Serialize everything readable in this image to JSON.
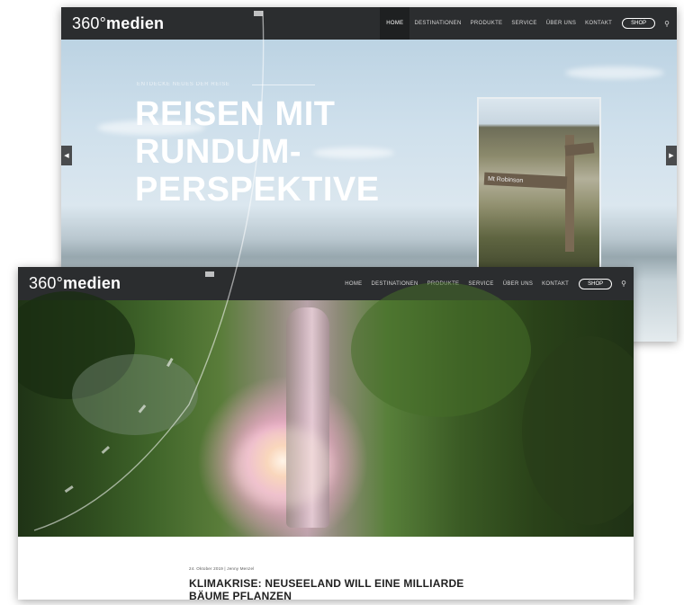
{
  "back_screenshot": {
    "logo": {
      "prefix": "360°",
      "bold": "medien"
    },
    "nav": {
      "items": [
        "HOME",
        "DESTINATIONEN",
        "PRODUKTE",
        "SERVICE",
        "ÜBER UNS",
        "KONTAKT"
      ],
      "active": "HOME",
      "shop_label": "SHOP",
      "search_icon": "search-icon"
    },
    "hero": {
      "kicker": "ENTDECKE NEUES DER REISE",
      "title_lines": [
        "REISEN MIT",
        "RUNDUM-",
        "PERSPEKTIVE"
      ],
      "photo_sign_text": "Mt Robinson",
      "prev_icon": "chevron-left-icon",
      "next_icon": "chevron-right-icon"
    }
  },
  "front_screenshot": {
    "logo": {
      "prefix": "360°",
      "bold": "medien"
    },
    "nav": {
      "items": [
        "HOME",
        "DESTINATIONEN",
        "PRODUKTE",
        "SERVICE",
        "ÜBER UNS",
        "KONTAKT"
      ],
      "shop_label": "SHOP",
      "search_icon": "search-icon"
    },
    "article": {
      "meta": "24. Oktober 2019 | Jenny Menzel",
      "headline": "KLIMAKRISE: NEUSEELAND WILL EINE MILLIARDE BÄUME PFLANZEN"
    }
  },
  "colors": {
    "navbar": "#2b2d2f",
    "nav_active": "#1e2021",
    "hero_sky": "#cfe0ec",
    "headline": "#1f1f1f"
  }
}
